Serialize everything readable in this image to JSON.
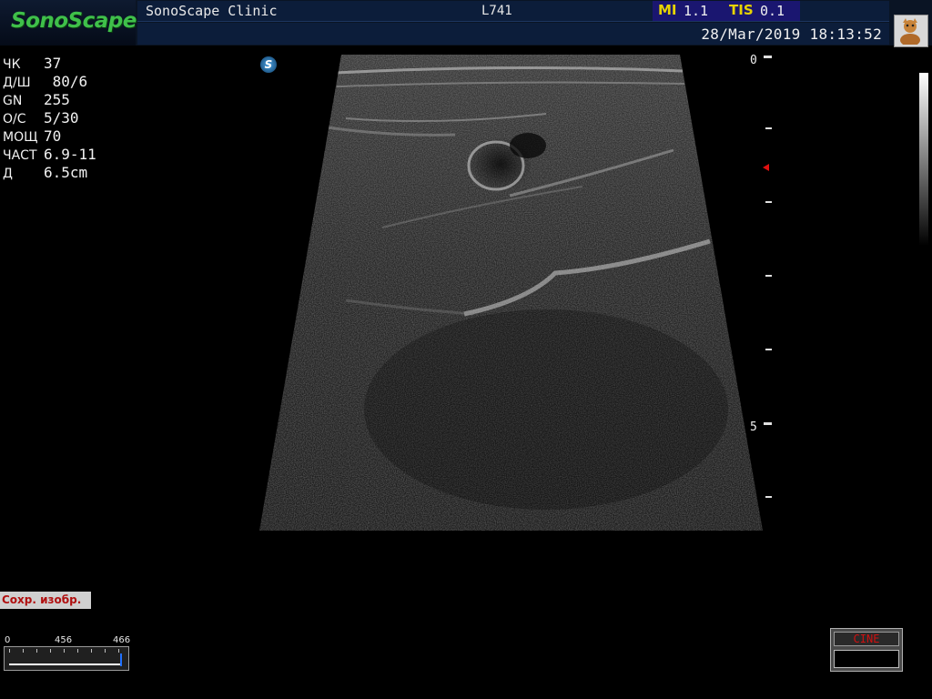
{
  "header": {
    "logo": "SonoScape",
    "hospital": "SonoScape Clinic",
    "probe": "L741",
    "mi_label": "MI",
    "mi_value": "1.1",
    "tis_label": "TIS",
    "tis_value": "0.1",
    "datetime": "28/Mar/2019 18:13:52",
    "user_icon": "user-avatar-icon"
  },
  "params": [
    {
      "label": "ЧК",
      "value": "37"
    },
    {
      "label": "Д/Ш",
      "value": " 80/6"
    },
    {
      "label": "GN",
      "value": "255"
    },
    {
      "label": "О/С",
      "value": "5/30"
    },
    {
      "label": "МОЩ",
      "value": "70"
    },
    {
      "label": "ЧАСТ",
      "value": "6.9-11"
    },
    {
      "label": "Д",
      "value": "6.5cm"
    }
  ],
  "logo_badge": "S",
  "depth_scale": {
    "labels": [
      "0",
      "5"
    ]
  },
  "save_label": "Сохр. изобр.",
  "cine_bar": {
    "start": "0",
    "current": "456",
    "total": "466",
    "progress_fraction": 0.98
  },
  "cine_box": {
    "title": "CINE"
  },
  "colors": {
    "logo": "#3fc04a",
    "mi_tis_label": "#e8d400",
    "header_bg": "#0c1d3a",
    "focus_marker": "#e01010",
    "cine_title": "#d01010"
  }
}
